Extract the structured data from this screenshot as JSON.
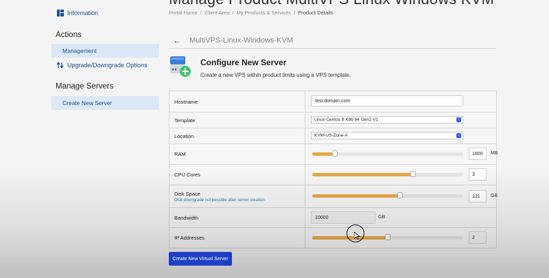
{
  "sidebar": {
    "top_link": "Information",
    "actions_heading": "Actions",
    "actions": [
      "Management",
      "Upgrade/Downgrade Options"
    ],
    "manage_heading": "Manage Servers",
    "manage_items": [
      "Create New Server"
    ]
  },
  "header": {
    "title": "Manage Product MultiVPS Linux Windows KVM",
    "breadcrumb": [
      "Portal Home",
      "Client Area",
      "My Products & Services",
      "Product Details"
    ]
  },
  "subheader": {
    "product_name": "MultiVPS-Linux-Windows-KVM"
  },
  "config": {
    "title": "Configure New Server",
    "subtitle": "Create a new VPS within product limits using a VPS template."
  },
  "form": {
    "hostname": {
      "label": "Hostname",
      "value": "test.domain.com"
    },
    "template": {
      "label": "Template",
      "value": "Linux Centos 8 X86 64 Gen2 V1"
    },
    "location": {
      "label": "Location",
      "value": "KVM-US-Zone-A"
    },
    "ram": {
      "label": "RAM",
      "value": "1800",
      "unit": "MB",
      "fraction": 0.15
    },
    "cpu": {
      "label": "CPU Cores",
      "value": "3",
      "fraction": 0.67
    },
    "disk": {
      "label": "Disk Space",
      "note": "Disk downgrade not possible after server creation.",
      "value": "121",
      "unit": "GB",
      "fraction": 0.58
    },
    "bandwidth": {
      "label": "Bandwidth",
      "value": "10000",
      "unit": "GB"
    },
    "ip": {
      "label": "IP Addresses",
      "value": "2",
      "fraction": 0.5
    }
  },
  "submit_label": "Create New Virtual Server",
  "colors": {
    "accent": "#1e3fc4",
    "slider": "#e8a84a",
    "link": "#1a4f8f"
  }
}
